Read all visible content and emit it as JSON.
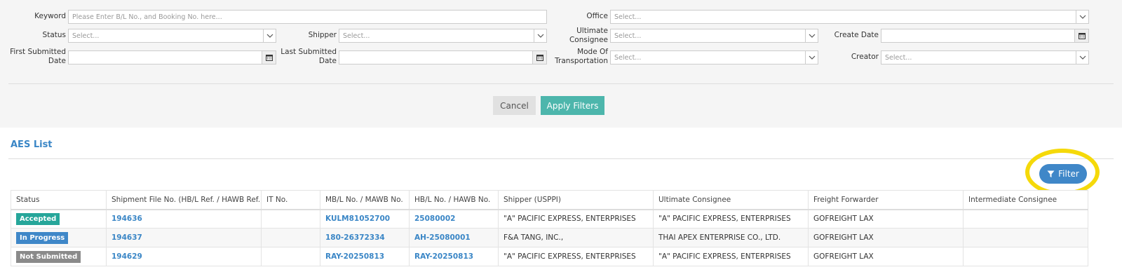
{
  "filters": {
    "keyword": {
      "label": "Keyword",
      "placeholder": "Please Enter B/L No., and Booking No. here..."
    },
    "office": {
      "label": "Office",
      "placeholder": "Select..."
    },
    "status": {
      "label": "Status",
      "placeholder": "Select..."
    },
    "shipper": {
      "label": "Shipper",
      "placeholder": "Select..."
    },
    "ultimate_consignee": {
      "label_line1": "Ultimate",
      "label_line2": "Consignee",
      "placeholder": "Select..."
    },
    "create_date": {
      "label": "Create Date",
      "placeholder": ""
    },
    "first_submitted_date": {
      "label_line1": "First Submitted",
      "label_line2": "Date",
      "placeholder": ""
    },
    "last_submitted_date": {
      "label_line1": "Last Submitted",
      "label_line2": "Date",
      "placeholder": ""
    },
    "mode_of_transportation": {
      "label_line1": "Mode Of",
      "label_line2": "Transportation",
      "placeholder": "Select..."
    },
    "creator": {
      "label": "Creator",
      "placeholder": "Select..."
    }
  },
  "actions": {
    "cancel": "Cancel",
    "apply": "Apply Filters"
  },
  "list": {
    "title": "AES List",
    "filter_button": "Filter"
  },
  "table": {
    "columns": [
      "Status",
      "Shipment File No. (HB/L Ref. / HAWB Ref.)",
      "IT No.",
      "MB/L No. / MAWB No.",
      "HB/L No. / HAWB No.",
      "Shipper (USPPI)",
      "Ultimate Consignee",
      "Freight Forwarder",
      "Intermediate Consignee"
    ],
    "rows": [
      {
        "status": "Accepted",
        "status_color": "#26a69a",
        "shipment_file": "194636",
        "it_no": "",
        "mbl": "KULM81052700",
        "hbl": "25080002",
        "shipper": "\"A\" PACIFIC EXPRESS, ENTERPRISES",
        "consignee": "\"A\" PACIFIC EXPRESS, ENTERPRISES",
        "forwarder": "GOFREIGHT LAX",
        "intermediate": ""
      },
      {
        "status": "In Progress",
        "status_color": "#3f87c8",
        "shipment_file": "194637",
        "it_no": "",
        "mbl": "180-26372334",
        "hbl": "AH-25080001",
        "shipper": "F&A TANG, INC.,",
        "consignee": "THAI APEX ENTERPRISE CO., LTD.",
        "forwarder": "GOFREIGHT LAX",
        "intermediate": ""
      },
      {
        "status": "Not Submitted",
        "status_color": "#8a8a8a",
        "shipment_file": "194629",
        "it_no": "",
        "mbl": "RAY-20250813",
        "hbl": "RAY-20250813",
        "shipper": "\"A\" PACIFIC EXPRESS, ENTERPRISES",
        "consignee": "\"A\" PACIFIC EXPRESS, ENTERPRISES",
        "forwarder": "GOFREIGHT LAX",
        "intermediate": ""
      }
    ]
  },
  "icons": {
    "dropdown": "chevron-down-icon",
    "calendar": "calendar-icon",
    "filter": "funnel-icon"
  },
  "colors": {
    "accent": "#3a86c6",
    "apply": "#4db6ac",
    "highlight": "#f5d90a"
  }
}
